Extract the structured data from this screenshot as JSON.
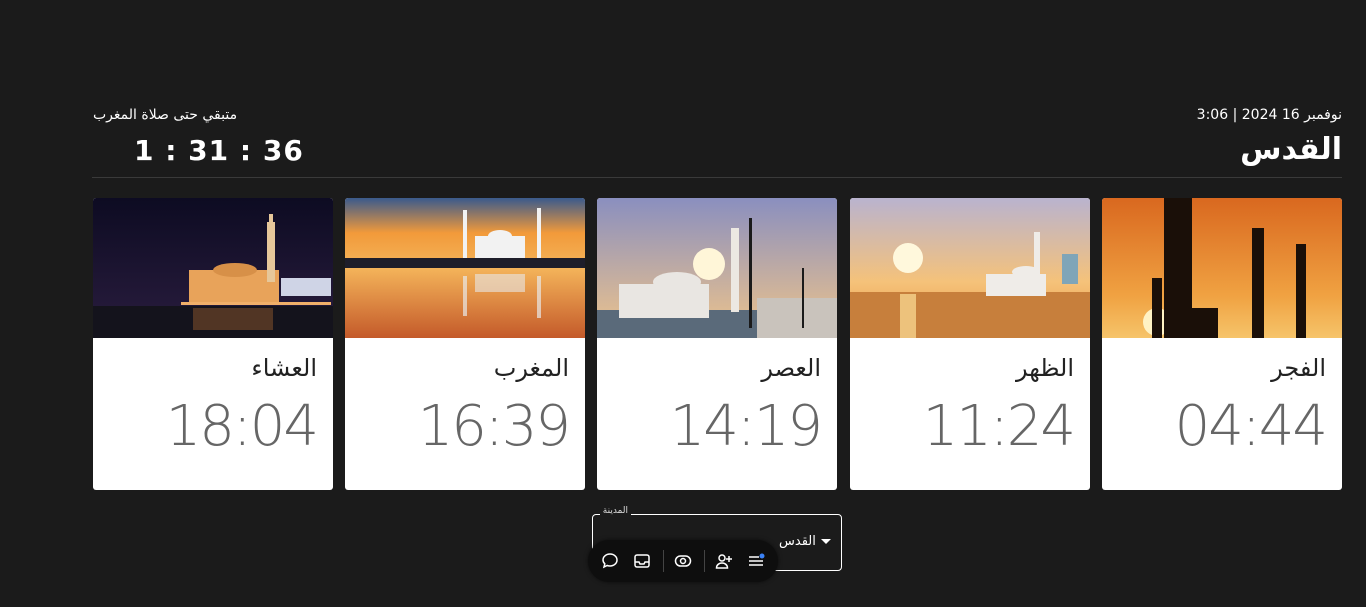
{
  "header": {
    "date_line": "نوفمبر 16 2024 | 3:06",
    "city": "القدس",
    "countdown_label": "متبقي حتى صلاة المغرب",
    "countdown": "1 : 31 : 36"
  },
  "prayers": [
    {
      "name": "العشاء",
      "time": "18:04",
      "image": "mosque-night"
    },
    {
      "name": "المغرب",
      "time": "16:39",
      "image": "mosque-sunset-reflection"
    },
    {
      "name": "العصر",
      "time": "14:19",
      "image": "mosque-afternoon"
    },
    {
      "name": "الظهر",
      "time": "11:24",
      "image": "mosque-sea-sun"
    },
    {
      "name": "الفجر",
      "time": "04:44",
      "image": "minaret-silhouettes-dawn"
    }
  ],
  "city_select": {
    "label": "المدينة",
    "value": "القدس"
  },
  "toolbar": {
    "icons": [
      "chat-icon",
      "inbox-icon",
      "eye-icon",
      "add-user-icon",
      "menu-icon"
    ],
    "notification_dot_color": "#3b82f6"
  }
}
